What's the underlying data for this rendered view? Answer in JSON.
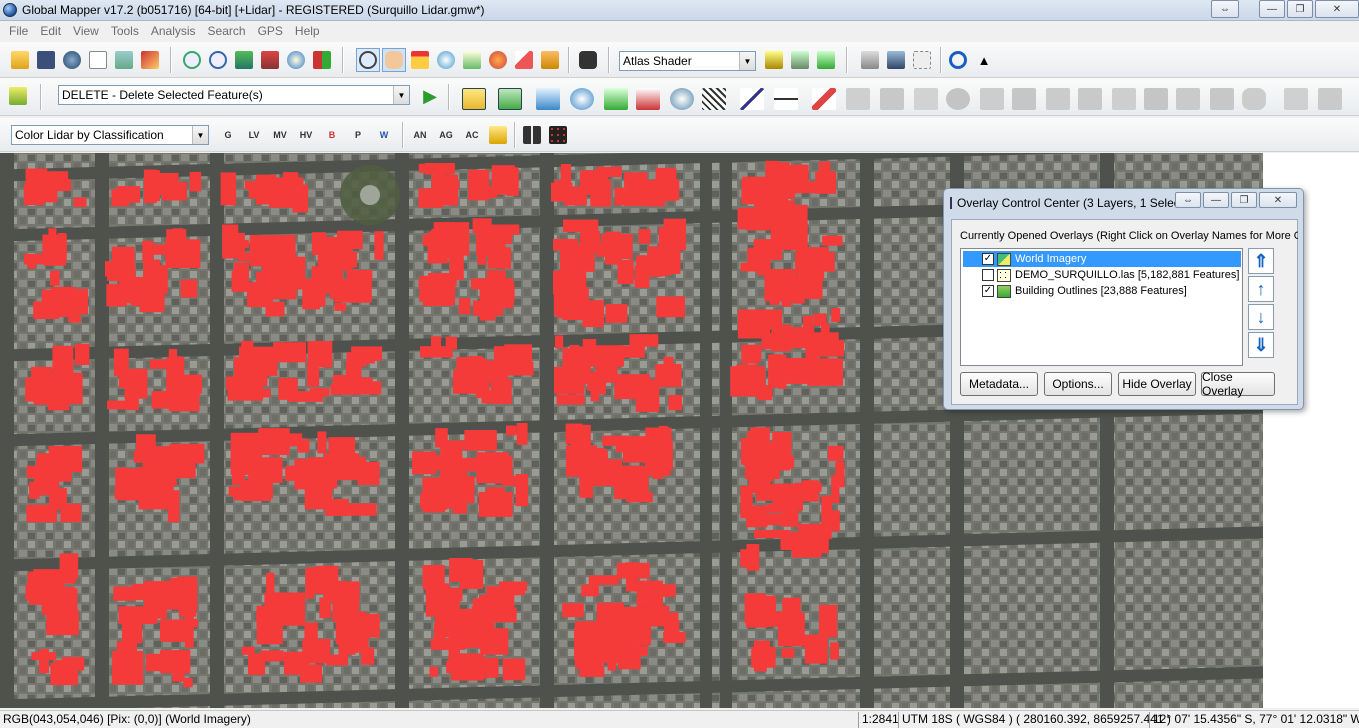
{
  "window": {
    "title": "Global Mapper v17.2 (b051716) [64-bit] [+Lidar] - REGISTERED (Surquillo Lidar.gmw*)",
    "minimize_glyph": "—",
    "maximize_glyph": "❐",
    "close_glyph": "✕",
    "extra_glyph": "⇔"
  },
  "menu": [
    "File",
    "Edit",
    "View",
    "Tools",
    "Analysis",
    "Search",
    "GPS",
    "Help"
  ],
  "toolbar": {
    "shader": "Atlas Shader",
    "digitizer_action": "DELETE - Delete Selected Feature(s)",
    "lidar_color": "Color Lidar by Classification",
    "lidar_class_buttons": [
      "G",
      "LV",
      "MV",
      "HV",
      "B",
      "P",
      "W"
    ],
    "lidar_extra_buttons": [
      "AN",
      "AG",
      "AC"
    ]
  },
  "overlay_center": {
    "title": "Overlay Control Center (3 Layers, 1 Selec...",
    "label": "Currently Opened Overlays (Right Click on Overlay Names for More Options)",
    "layers": [
      {
        "name": "World Imagery",
        "checked": true,
        "selected": true
      },
      {
        "name": "DEMO_SURQUILLO.las [5,182,881 Features]",
        "checked": false,
        "selected": false
      },
      {
        "name": "Building Outlines [23,888 Features]",
        "checked": true,
        "selected": false
      }
    ],
    "buttons": {
      "metadata": "Metadata...",
      "options": "Options...",
      "hide": "Hide Overlay",
      "close": "Close Overlay"
    }
  },
  "status": {
    "pixel": "RGB(043,054,046) [Pix: (0,0)] (World Imagery)",
    "scale": "1:2841",
    "projection": "UTM 18S ( WGS84 ) ( 280160.392, 8659257.441 )",
    "latlon": "12° 07' 15.4356\" S, 77° 01' 12.0318\" W"
  },
  "colors": {
    "building_fill": "#f53a3a",
    "selection": "#3399ff",
    "dialog_frame": "#cfdbe9"
  }
}
